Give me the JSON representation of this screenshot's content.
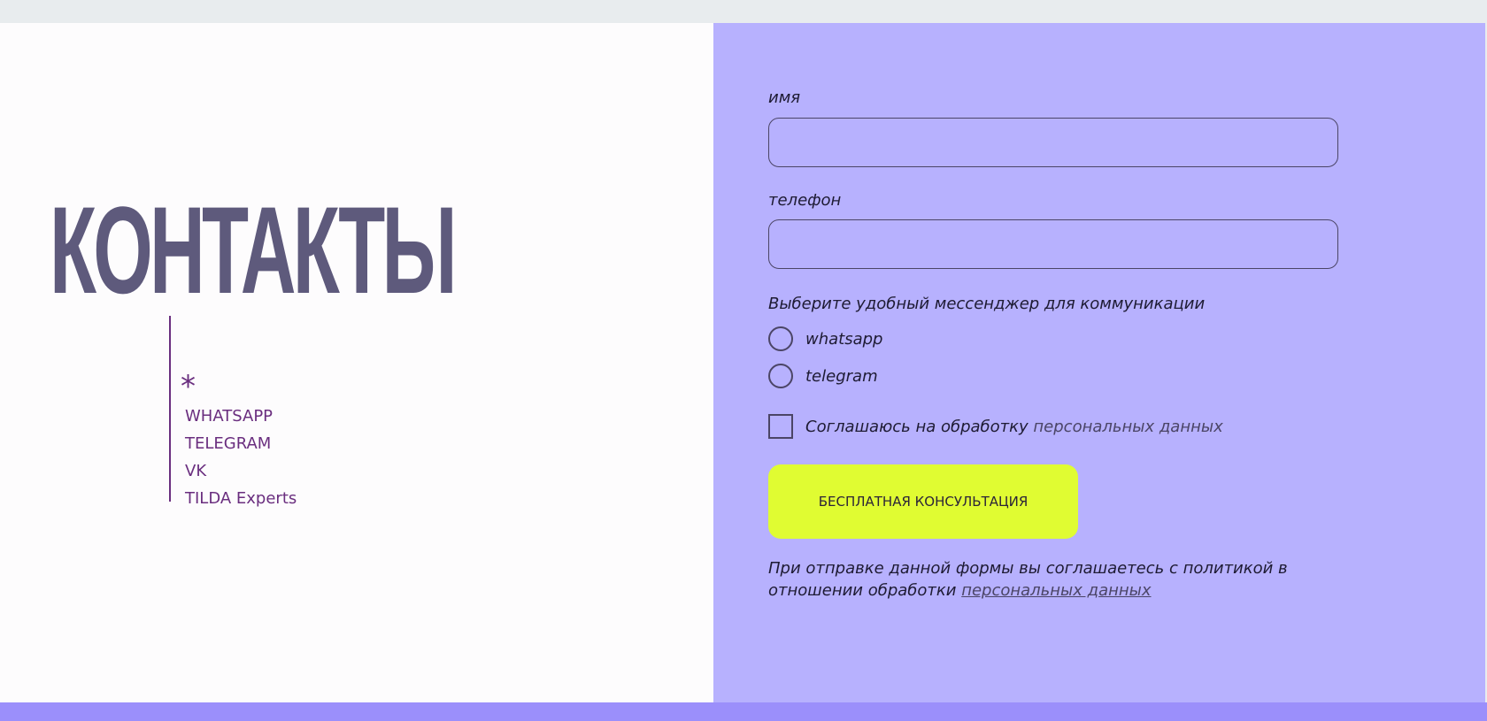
{
  "contacts": {
    "title": "КОНТАКТЫ",
    "asterisk": "*",
    "links": [
      "WHATSAPP",
      "TELEGRAM",
      "VK",
      "TILDA Experts"
    ]
  },
  "form": {
    "name_label": "имя",
    "phone_label": "телефон",
    "messenger_prompt": "Выберите удобный мессенджер для коммуникации",
    "messenger_options": [
      "whatsapp",
      "telegram"
    ],
    "consent_text": "Соглашаюсь на обработку",
    "consent_link": "персональных данных",
    "submit_label": "БЕСПЛАТНАЯ КОНСУЛЬТАЦИЯ",
    "policy_text": "При отправке данной формы вы соглашаетесь с политикой в отношении обработки",
    "policy_link": "персональных данных"
  },
  "colors": {
    "heading": "#5e5a7c",
    "link": "#6a2e7f",
    "form_background": "#b7b1fe",
    "button": "#e0fc32",
    "bottom_band": "#9b8ffb"
  }
}
